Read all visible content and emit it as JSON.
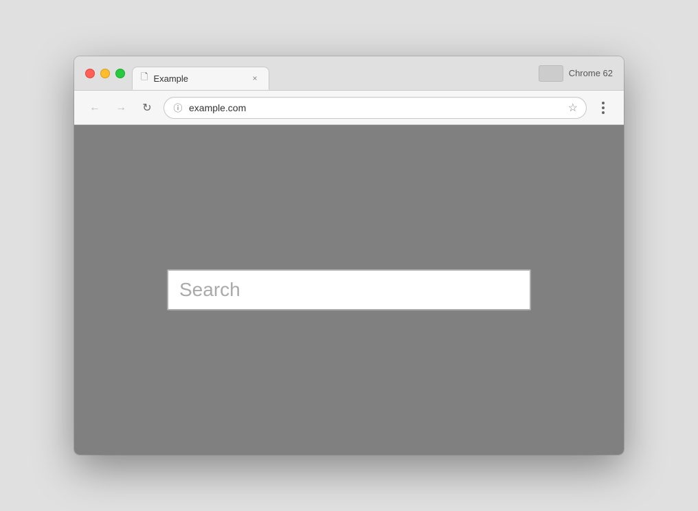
{
  "browser": {
    "title": "Example",
    "tab_close": "×",
    "chrome_version": "Chrome 62",
    "url": "example.com",
    "nav": {
      "back": "←",
      "forward": "→",
      "reload": "↻"
    }
  },
  "page": {
    "search_placeholder": "Search"
  }
}
